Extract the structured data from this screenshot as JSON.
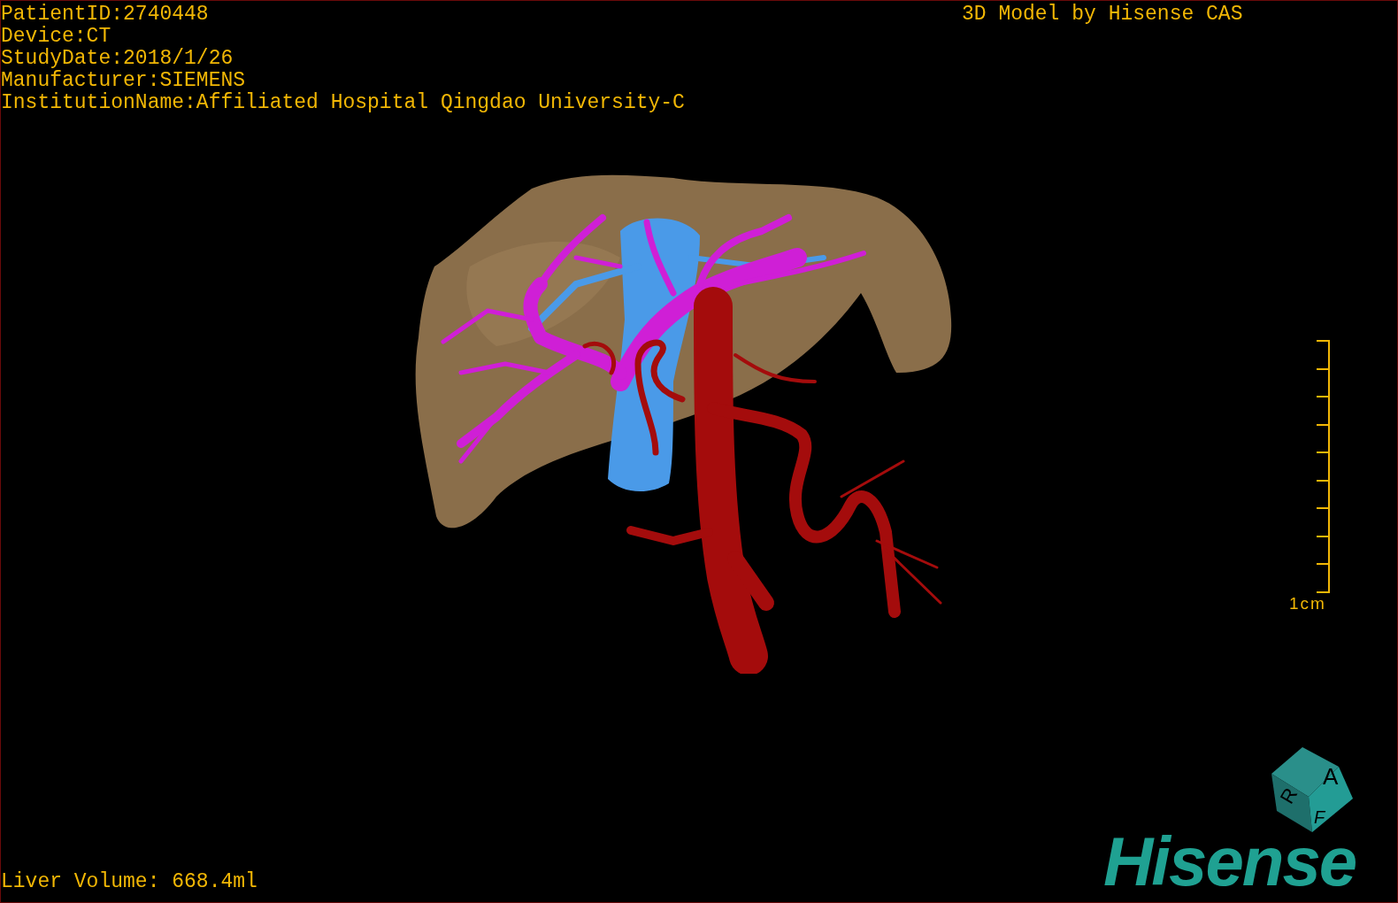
{
  "info_lines": [
    "PatientID:2740448",
    "Device:CT",
    "StudyDate:2018/1/26",
    "Manufacturer:SIEMENS",
    "InstitutionName:Affiliated Hospital Qingdao University-C"
  ],
  "title": "3D Model by Hisense CAS",
  "scale_bar": {
    "label": "1cm"
  },
  "liver_volume": "Liver Volume: 668.4ml",
  "orientation_cube": {
    "faces": [
      "A",
      "R",
      "F"
    ]
  },
  "logo": "Hisense"
}
